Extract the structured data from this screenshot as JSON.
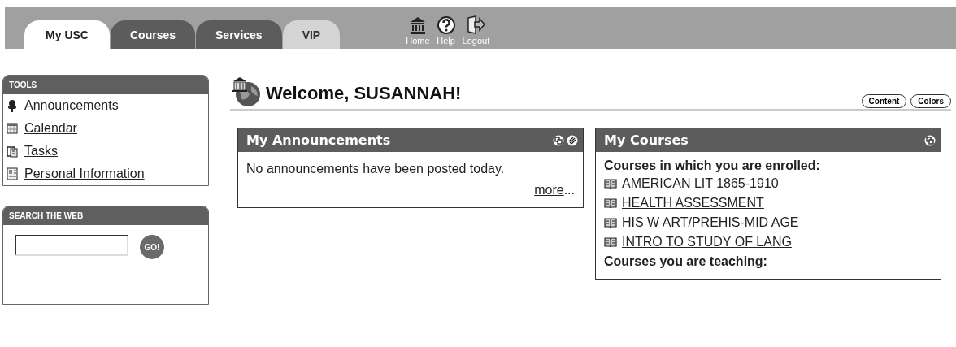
{
  "tabs": [
    {
      "label": "My USC",
      "selected": true,
      "kind": "light"
    },
    {
      "label": "Courses",
      "selected": false,
      "kind": "dark"
    },
    {
      "label": "Services",
      "selected": false,
      "kind": "dark"
    },
    {
      "label": "VIP",
      "selected": false,
      "kind": "light"
    }
  ],
  "toolbar": [
    {
      "label": "Home",
      "kind": "home"
    },
    {
      "label": "Help",
      "kind": "help"
    },
    {
      "label": "Logout",
      "kind": "logout"
    }
  ],
  "tools": {
    "title": "TOOLS",
    "items": [
      {
        "label": "Announcements",
        "kind": "pin"
      },
      {
        "label": "Calendar",
        "kind": "calendar"
      },
      {
        "label": "Tasks",
        "kind": "clipboard"
      },
      {
        "label": "Personal Information",
        "kind": "card"
      }
    ]
  },
  "search": {
    "title": "SEARCH THE WEB",
    "button": "GO!"
  },
  "welcome": {
    "title": "Welcome, SUSANNAH!",
    "buttons": [
      "Content",
      "Colors"
    ]
  },
  "announcements": {
    "title": "My Announcements",
    "message": "No announcements have been posted today.",
    "more_link": "more",
    "more_suffix": "..."
  },
  "courses": {
    "title": "My Courses",
    "enrolled_heading": "Courses in which you are enrolled:",
    "enrolled": [
      "AMERICAN LIT 1865-1910",
      "HEALTH ASSESSMENT",
      "HIS W ART/PREHIS-MID AGE",
      "INTRO TO STUDY OF LANG"
    ],
    "teaching_heading": "Courses you are teaching:"
  }
}
